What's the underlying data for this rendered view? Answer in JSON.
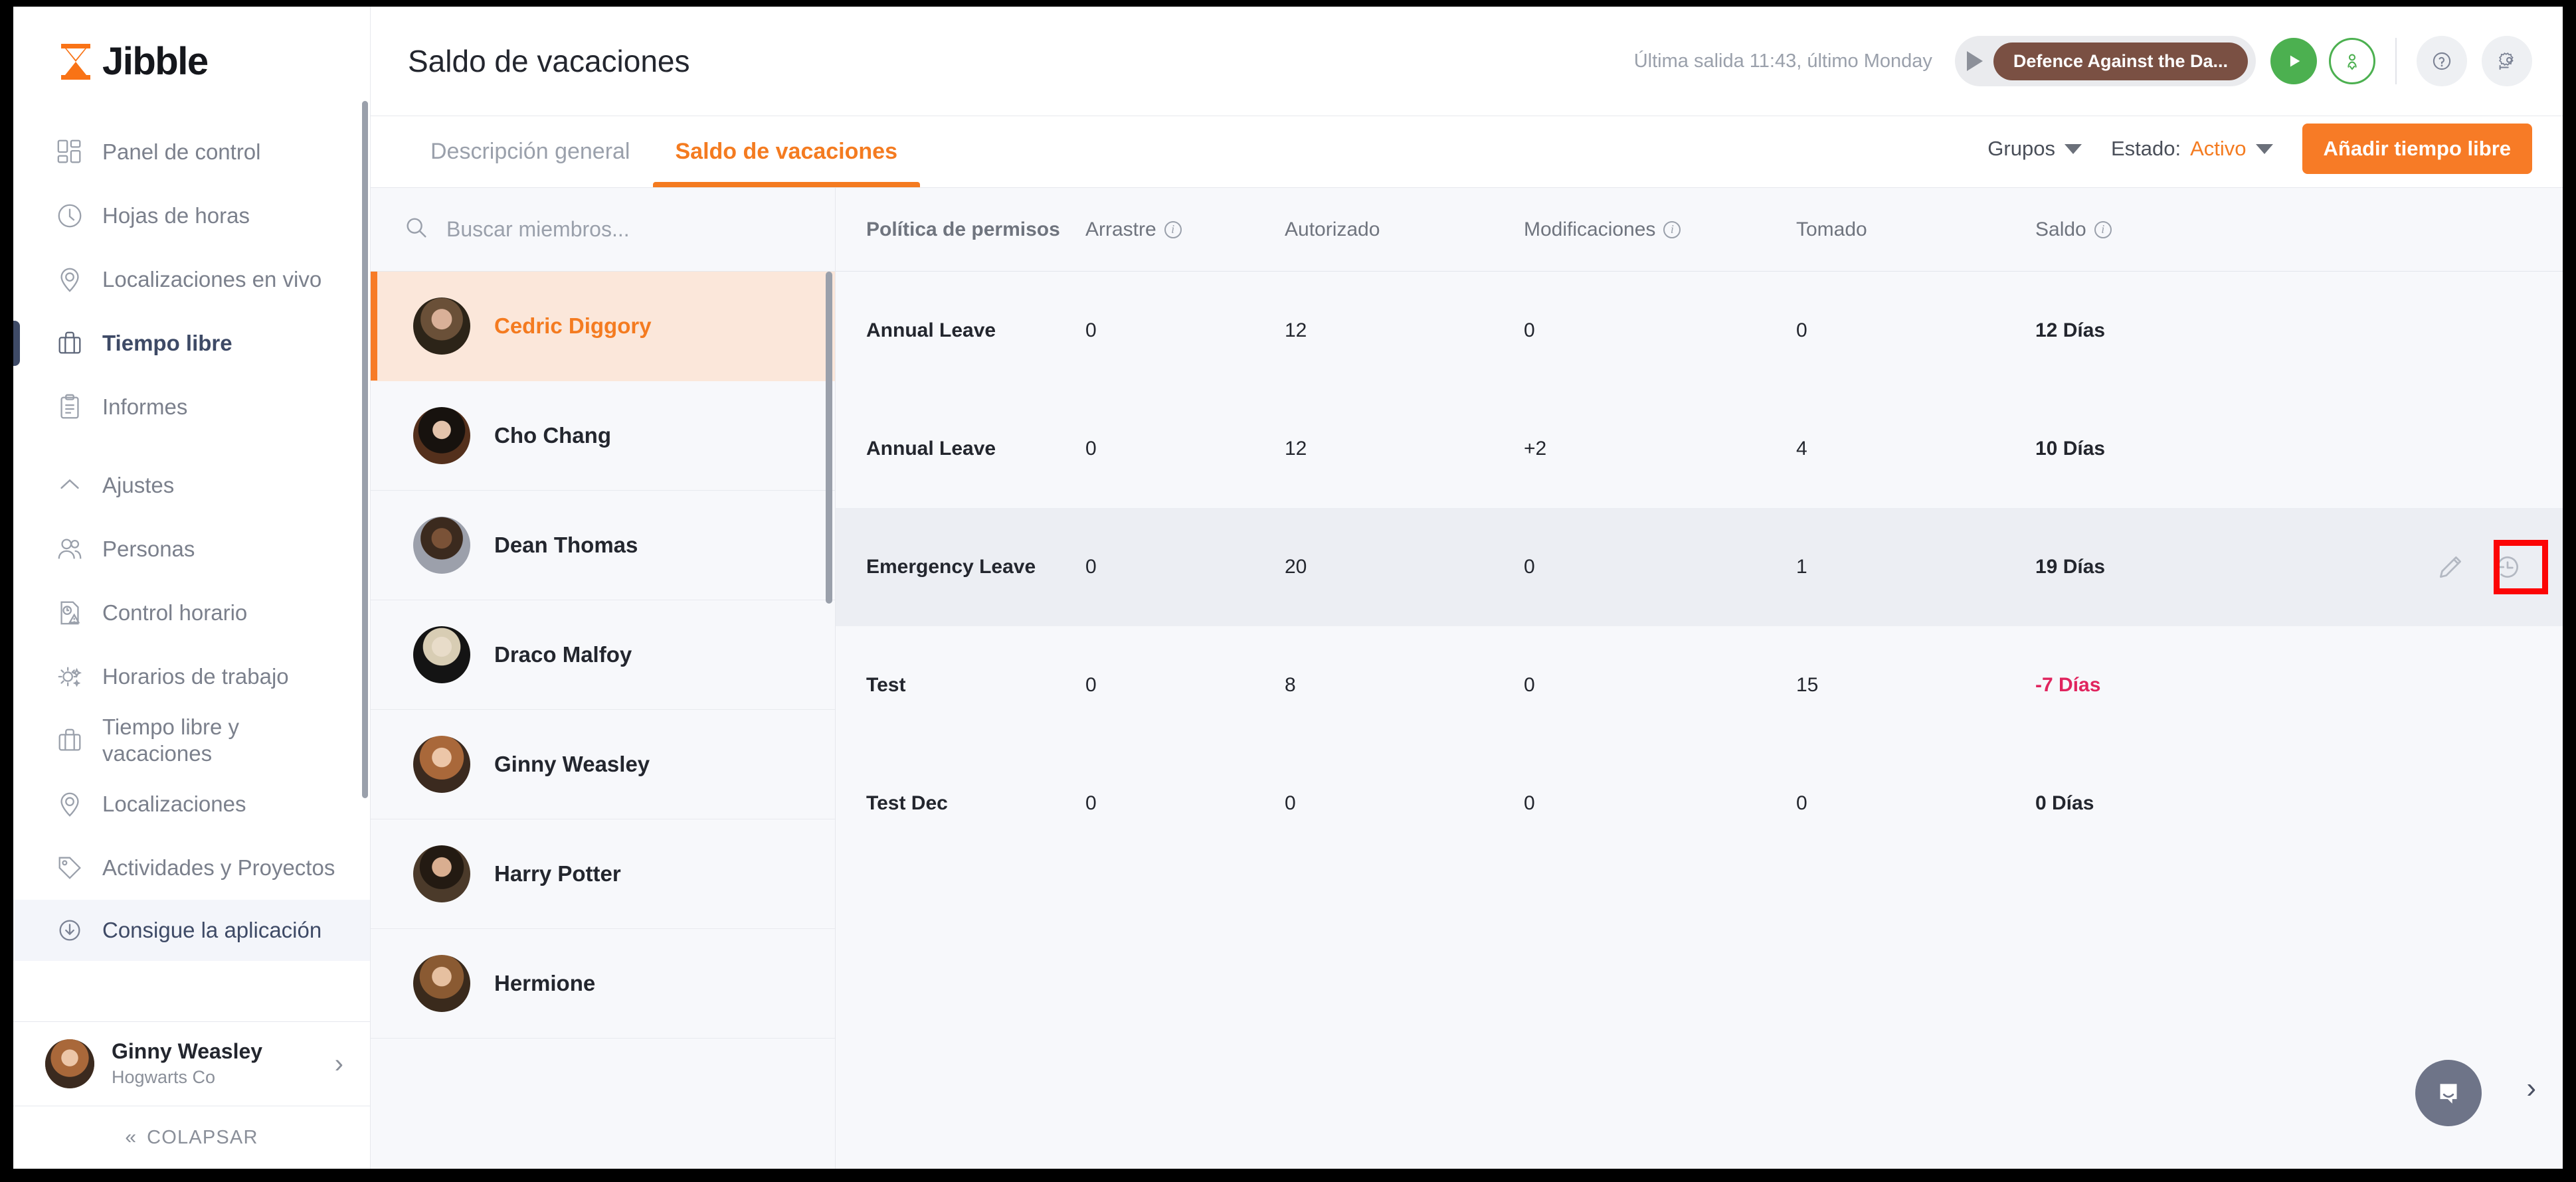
{
  "brand": {
    "name": "Jibble",
    "accent": "#f77b26",
    "logo_icon": "hourglass-icon"
  },
  "sidebar": {
    "primary_items": [
      {
        "label": "Panel de control",
        "icon": "dashboard-icon",
        "active": false
      },
      {
        "label": "Hojas de horas",
        "icon": "clock-icon",
        "active": false
      },
      {
        "label": "Localizaciones en vivo",
        "icon": "map-pin-icon",
        "active": false
      },
      {
        "label": "Tiempo libre",
        "icon": "briefcase-icon",
        "active": true
      },
      {
        "label": "Informes",
        "icon": "clipboard-icon",
        "active": false
      }
    ],
    "settings_group": {
      "label": "Ajustes",
      "icon": "chevron-up-icon",
      "items": [
        {
          "label": "Personas",
          "icon": "people-icon"
        },
        {
          "label": "Control horario",
          "icon": "time-control-icon"
        },
        {
          "label": "Horarios de trabajo",
          "icon": "schedule-sun-icon"
        },
        {
          "label": "Tiempo libre y vacaciones",
          "icon": "briefcase-icon"
        },
        {
          "label": "Localizaciones",
          "icon": "map-pin-icon"
        },
        {
          "label": "Actividades y Proyectos",
          "icon": "tag-icon"
        }
      ]
    },
    "get_app": {
      "label": "Consigue la aplicación",
      "icon": "download-circle-icon"
    },
    "user": {
      "name": "Ginny Weasley",
      "org": "Hogwarts Co",
      "avatar": "ginny-avatar",
      "chevron": "chevron-right-icon"
    },
    "collapse": {
      "label": "COLAPSAR",
      "icon": "chevrons-left-icon"
    }
  },
  "topbar": {
    "title": "Saldo de vacaciones",
    "last_out": "Última salida 11:43, último Monday",
    "timer": {
      "play_icon": "play-triangle-icon",
      "activity_label": "Defence Against the Da..."
    },
    "start_button": {
      "icon": "play-icon",
      "color": "#4cb050"
    },
    "person_button": {
      "icon": "person-check-icon",
      "color": "#4cb050"
    },
    "help_button": {
      "icon": "question-circle-icon"
    },
    "settings_button": {
      "icon": "gear-icon"
    }
  },
  "tabs": [
    {
      "label": "Descripción general",
      "active": false
    },
    {
      "label": "Saldo de vacaciones",
      "active": true
    }
  ],
  "filters": {
    "groups": {
      "label": "Grupos",
      "icon": "chevron-down-icon"
    },
    "status": {
      "label": "Estado:",
      "value": "Activo",
      "icon": "chevron-down-icon"
    },
    "add_button": "Añadir tiempo libre"
  },
  "members_panel": {
    "search_placeholder": "Buscar miembros...",
    "search_value": "",
    "search_icon": "search-icon",
    "members": [
      {
        "name": "Cedric Diggory",
        "avatar": "cedric-avatar",
        "selected": true,
        "face": "f-cedric"
      },
      {
        "name": "Cho Chang",
        "avatar": "cho-avatar",
        "selected": false,
        "face": "f-cho"
      },
      {
        "name": "Dean Thomas",
        "avatar": "dean-avatar",
        "selected": false,
        "face": "f-dean"
      },
      {
        "name": "Draco Malfoy",
        "avatar": "draco-avatar",
        "selected": false,
        "face": "f-draco"
      },
      {
        "name": "Ginny Weasley",
        "avatar": "ginny-avatar",
        "selected": false,
        "face": "f-ginny"
      },
      {
        "name": "Harry Potter",
        "avatar": "harry-avatar",
        "selected": false,
        "face": "f-harry"
      },
      {
        "name": "Hermione",
        "avatar": "hermione-avatar",
        "selected": false,
        "face": "f-hermione"
      }
    ]
  },
  "table": {
    "columns": [
      {
        "label": "Política de permisos",
        "info": false
      },
      {
        "label": "Arrastre",
        "info": true
      },
      {
        "label": "Autorizado",
        "info": false
      },
      {
        "label": "Modificaciones",
        "info": true
      },
      {
        "label": "Tomado",
        "info": false
      },
      {
        "label": "Saldo",
        "info": true
      }
    ],
    "rows": [
      {
        "policy": "Annual Leave",
        "carryover": "0",
        "authorized": "12",
        "modifications": "0",
        "taken": "0",
        "balance": "12 Días",
        "negative": false,
        "highlighted": false
      },
      {
        "policy": "Annual Leave",
        "carryover": "0",
        "authorized": "12",
        "modifications": "+2",
        "taken": "4",
        "balance": "10 Días",
        "negative": false,
        "highlighted": false
      },
      {
        "policy": "Emergency Leave",
        "carryover": "0",
        "authorized": "20",
        "modifications": "0",
        "taken": "1",
        "balance": "19 Días",
        "negative": false,
        "highlighted": true
      },
      {
        "policy": "Test",
        "carryover": "0",
        "authorized": "8",
        "modifications": "0",
        "taken": "15",
        "balance": "-7 Días",
        "negative": true,
        "highlighted": false
      },
      {
        "policy": "Test Dec",
        "carryover": "0",
        "authorized": "0",
        "modifications": "0",
        "taken": "0",
        "balance": "0 Días",
        "negative": false,
        "highlighted": false
      }
    ],
    "row_actions": {
      "edit_icon": "pencil-icon",
      "history_icon": "history-clock-icon"
    },
    "annotation": {
      "color": "#fc0505",
      "target": "history-clock-icon"
    }
  },
  "chat": {
    "icon": "chat-bubble-icon",
    "color": "#6e7488"
  },
  "bottom_chevron": {
    "icon": "chevron-right-icon"
  }
}
